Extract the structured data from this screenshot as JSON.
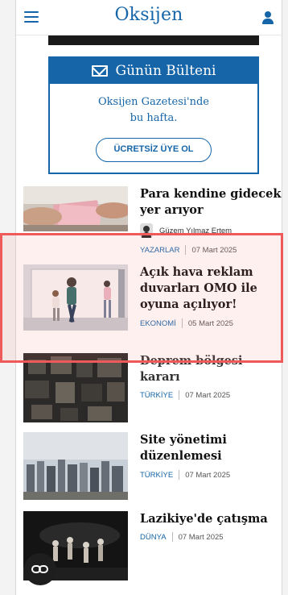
{
  "header": {
    "logo": "Oksijen"
  },
  "newsletter": {
    "title": "Günün Bülteni",
    "line1": "Oksijen Gazetesi'nde",
    "line2": "bu hafta.",
    "button": "ÜCRETSİZ ÜYE OL"
  },
  "articles": [
    {
      "title": "Para kendine gidecek yer arıyor",
      "author": "Güzem Yılmaz Ertem",
      "category": "YAZARLAR",
      "date": "07 Mart 2025"
    },
    {
      "title": "Açık hava reklam duvarları OMO ile oyuna açılıyor!",
      "category": "EKONOMİ",
      "date": "05 Mart 2025"
    },
    {
      "title": "Deprem bölgesi kararı",
      "category": "TÜRKİYE",
      "date": "07 Mart 2025"
    },
    {
      "title": "Site yönetimi düzenlemesi",
      "category": "TÜRKİYE",
      "date": "07 Mart 2025"
    },
    {
      "title": "Lazikiye'de çatışma",
      "category": "DÜNYA",
      "date": "07 Mart 2025"
    }
  ],
  "colors": {
    "brand": "#1565a8",
    "highlight": "#ee5a5a"
  }
}
